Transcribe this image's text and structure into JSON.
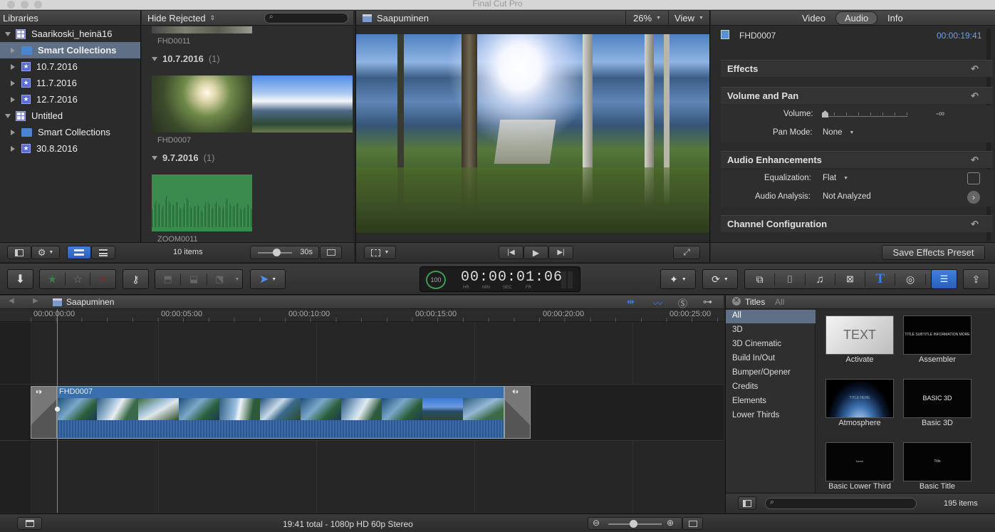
{
  "app_title": "Final Cut Pro",
  "browser": {
    "header": "Libraries",
    "filter": "Hide Rejected",
    "item_count": "10 items",
    "zoom": "30s"
  },
  "libraries": [
    {
      "label": "Saarikoski_heinä16",
      "kind": "library",
      "level": 0,
      "open": true
    },
    {
      "label": "Smart Collections",
      "kind": "folder",
      "level": 1,
      "selected": true
    },
    {
      "label": "10.7.2016",
      "kind": "event",
      "level": 1
    },
    {
      "label": "11.7.2016",
      "kind": "event",
      "level": 1
    },
    {
      "label": "12.7.2016",
      "kind": "event",
      "level": 1
    },
    {
      "label": "Untitled",
      "kind": "library",
      "level": 0,
      "open": true
    },
    {
      "label": "Smart Collections",
      "kind": "folder",
      "level": 1
    },
    {
      "label": "30.8.2016",
      "kind": "event",
      "level": 1
    }
  ],
  "clips": {
    "top_clip": "FHD0011",
    "group1": {
      "date": "10.7.2016",
      "count": "(1)",
      "clip": "FHD0007"
    },
    "group2": {
      "date": "9.7.2016",
      "count": "(1)",
      "clip": "ZOOM0011"
    }
  },
  "viewer": {
    "title": "Saapuminen",
    "zoom": "26%",
    "view_label": "View"
  },
  "timecode": {
    "pct": "100",
    "value": "00:00:01:06",
    "hr": "HR",
    "min": "MIN",
    "sec": "SEC",
    "fr": "FR"
  },
  "inspector": {
    "tabs": [
      "Video",
      "Audio",
      "Info"
    ],
    "active_tab": "Audio",
    "clip_name": "FHD0007",
    "duration": "00:00:19:41",
    "sections": {
      "effects": "Effects",
      "volume_pan": "Volume and Pan",
      "audio_enh": "Audio Enhancements",
      "channel": "Channel Configuration"
    },
    "volume_label": "Volume:",
    "volume_value": "-∞",
    "pan_label": "Pan Mode:",
    "pan_value": "None",
    "eq_label": "Equalization:",
    "eq_value": "Flat",
    "analysis_label": "Audio Analysis:",
    "analysis_value": "Not Analyzed",
    "save_preset": "Save Effects Preset"
  },
  "timeline": {
    "project": "Saapuminen",
    "ruler": [
      "00:00:00:00",
      "00:00:05:00",
      "00:00:10:00",
      "00:00:15:00",
      "00:00:20:00",
      "00:00:25:00"
    ],
    "clip": "FHD0007"
  },
  "titles": {
    "header": "Titles",
    "filter": "All",
    "categories": [
      "All",
      "3D",
      "3D Cinematic",
      "Build In/Out",
      "Bumper/Opener",
      "Credits",
      "Elements",
      "Lower Thirds"
    ],
    "selected_category": "All",
    "items": [
      {
        "name": "Activate",
        "preview": "TEXT"
      },
      {
        "name": "Assembler",
        "preview": "TITLE SUBTITLE INFORMATION MORE"
      },
      {
        "name": "Atmosphere",
        "preview": "TITLE HERE"
      },
      {
        "name": "Basic 3D",
        "preview": "BASIC 3D"
      },
      {
        "name": "Basic Lower Third",
        "preview": "Name"
      },
      {
        "name": "Basic Title",
        "preview": "Title"
      }
    ],
    "count": "195 items"
  },
  "status": {
    "summary": "19:41 total - 1080p HD 60p Stereo"
  },
  "colors": {
    "accent": "#3f7fe0",
    "selection": "#5f6f86",
    "clip_audio": "#2f5f99",
    "titles_blue": "#3d7ff0"
  }
}
